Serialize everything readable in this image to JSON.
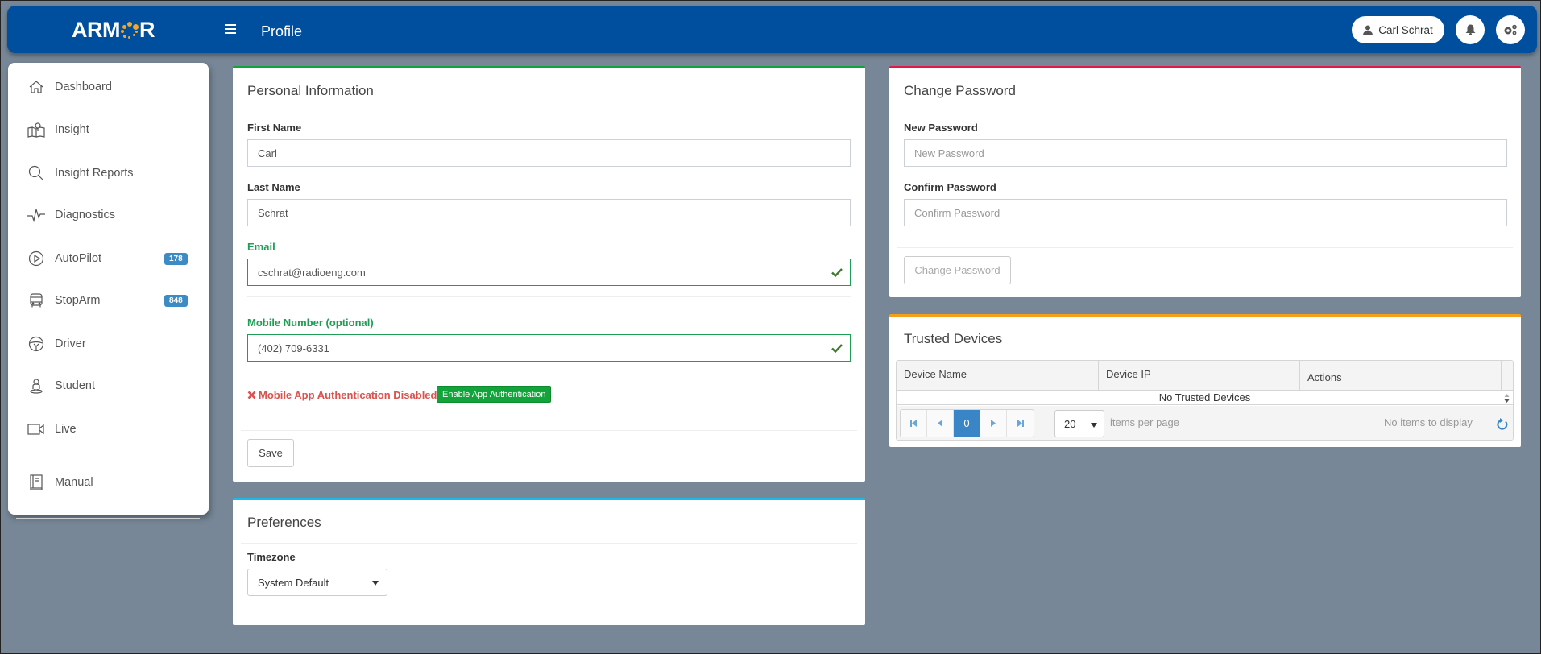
{
  "header": {
    "logo_text": "ARM",
    "logo_text_end": "R",
    "page_title": "Profile",
    "user_name": "Carl Schrat",
    "icons": [
      "menu-icon",
      "user-icon",
      "bell-icon",
      "settings-icon"
    ]
  },
  "sidebar": {
    "items": [
      {
        "label": "Dashboard",
        "icon": "home-icon"
      },
      {
        "label": "Insight",
        "icon": "map-icon"
      },
      {
        "label": "Insight Reports",
        "icon": "search-icon"
      },
      {
        "label": "Diagnostics",
        "icon": "pulse-icon"
      },
      {
        "label": "AutoPilot",
        "icon": "play-circle-icon",
        "badge": "178"
      },
      {
        "label": "StopArm",
        "icon": "bus-icon",
        "badge": "848"
      },
      {
        "label": "Driver",
        "icon": "steering-wheel-icon"
      },
      {
        "label": "Student",
        "icon": "student-icon"
      },
      {
        "label": "Live",
        "icon": "video-icon"
      }
    ],
    "footer_items": [
      {
        "label": "Manual",
        "icon": "book-icon"
      }
    ],
    "badge_color": "#3d8bc4"
  },
  "personal": {
    "title": "Personal Information",
    "accent": "#12a33a",
    "first_name_label": "First Name",
    "first_name_value": "Carl",
    "last_name_label": "Last Name",
    "last_name_value": "Schrat",
    "email_label": "Email",
    "email_value": "cschrat@radioeng.com",
    "mobile_label": "Mobile Number (optional)",
    "mobile_value": "(402) 709-6331",
    "auth_status": "Mobile App Authentication Disabled",
    "auth_button": "Enable App Authentication",
    "save_button": "Save"
  },
  "preferences": {
    "title": "Preferences",
    "accent": "#1cb8e8",
    "timezone_label": "Timezone",
    "timezone_value": "System Default"
  },
  "password": {
    "title": "Change Password",
    "accent": "#e3174b",
    "new_label": "New Password",
    "new_placeholder": "New Password",
    "confirm_label": "Confirm Password",
    "confirm_placeholder": "Confirm Password",
    "submit_button": "Change Password"
  },
  "trusted_devices": {
    "title": "Trusted Devices",
    "accent": "#f5a01a",
    "columns": [
      "Device Name",
      "Device IP",
      "Actions"
    ],
    "empty_text": "No Trusted Devices",
    "current_page": "0",
    "page_size": "20",
    "items_per_page_label": "items per page",
    "status_text": "No items to display"
  }
}
